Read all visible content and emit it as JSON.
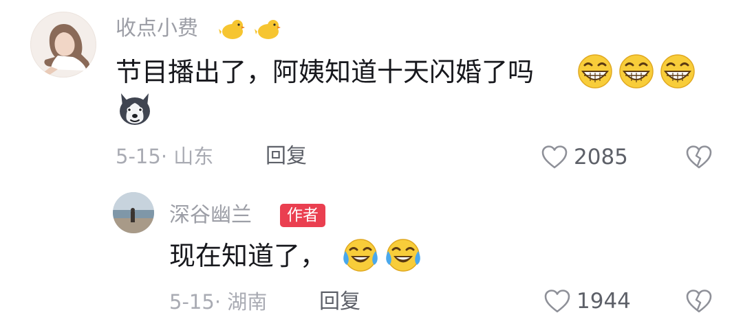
{
  "comment": {
    "username": "收点小费",
    "text": "节目播出了，阿姨知道十天闪婚了吗",
    "date_location": "5-15· 山东",
    "reply_label": "回复",
    "like_count": "2085"
  },
  "reply": {
    "username": "深谷幽兰",
    "badge": "作者",
    "text": "现在知道了，",
    "date_location": "5-15· 湖南",
    "reply_label": "回复",
    "like_count": "1944"
  },
  "colors": {
    "badge": "#ea3f50",
    "username": "#9c9ea6",
    "meta": "#a9abb3",
    "text": "#17181d"
  },
  "icons": [
    "duck-emoji",
    "duck-emoji",
    "grin-emoji",
    "grin-emoji",
    "grin-emoji",
    "husky-emoji",
    "heart-outline-icon",
    "broken-heart-icon",
    "laugh-cry-emoji",
    "laugh-cry-emoji"
  ]
}
